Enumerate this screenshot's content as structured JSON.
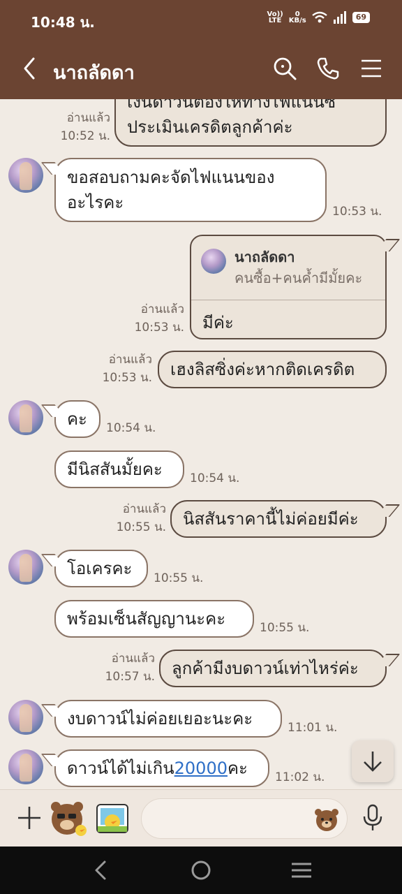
{
  "status_bar": {
    "time": "10:48 น.",
    "net_top": "Vo))",
    "net_bottom": "LTE",
    "speed_top": "0",
    "speed_bottom": "KB/s",
    "battery": "69"
  },
  "header": {
    "title": "นาถลัดดา",
    "back_icon": "chevron-left-icon",
    "icons": [
      "search-icon",
      "phone-icon",
      "menu-icon"
    ]
  },
  "messages": [
    {
      "dir": "out",
      "lines": [
        "เงินดาวน์ต้องให้ทางไฟแนนซ์",
        "ประเมินเครดิตลูกค้าค่ะ"
      ],
      "read": "อ่านแล้ว",
      "time": "10:52 น."
    },
    {
      "dir": "in",
      "lines": [
        "ขอสอบถามคะจัดไฟแนนของ",
        "อะไรคะ"
      ],
      "time": "10:53 น."
    },
    {
      "dir": "out",
      "reply_to": {
        "name": "นาถลัดดา",
        "text": "คนซื้อ+คนค้ำมีมั้ยคะ"
      },
      "text": "มีค่ะ",
      "read": "อ่านแล้ว",
      "time": "10:53 น."
    },
    {
      "dir": "out",
      "text": "เฮงลิสซิ่งค่ะหากติดเครดิต",
      "read": "อ่านแล้ว",
      "time": "10:53 น."
    },
    {
      "dir": "in",
      "text": "คะ",
      "time": "10:54 น."
    },
    {
      "dir": "in",
      "text": "มีนิสสันมั้ยคะ",
      "time": "10:54 น."
    },
    {
      "dir": "out",
      "text": "นิสสันราคานี้ไม่ค่อยมีค่ะ",
      "read": "อ่านแล้ว",
      "time": "10:55 น."
    },
    {
      "dir": "in",
      "text": "โอเครคะ",
      "time": "10:55 น."
    },
    {
      "dir": "in",
      "text": "พร้อมเซ็นสัญญานะคะ",
      "time": "10:55 น."
    },
    {
      "dir": "out",
      "text": "ลูกค้ามีงบดาวน์เท่าไหร่ค่ะ",
      "read": "อ่านแล้ว",
      "time": "10:57 น."
    },
    {
      "dir": "in",
      "text": "งบดาวน์ไม่ค่อยเยอะนะคะ",
      "time": "11:01 น."
    },
    {
      "dir": "in",
      "text_before": "ดาวน์ได้ไม่เกิน",
      "link": "20000",
      "text_after": "คะ",
      "time": "11:02 น."
    }
  ],
  "input": {
    "placeholder": "",
    "icons": [
      "plus-icon",
      "sticker-icon",
      "photo-sticker-icon",
      "emoji-icon",
      "microphone-icon"
    ]
  },
  "nav": [
    "back-icon",
    "home-icon",
    "recents-icon"
  ],
  "colors": {
    "header": "#6b4432",
    "background": "#f1ebe4",
    "bubble_out": "#ece4da",
    "link": "#2e6fc7"
  }
}
